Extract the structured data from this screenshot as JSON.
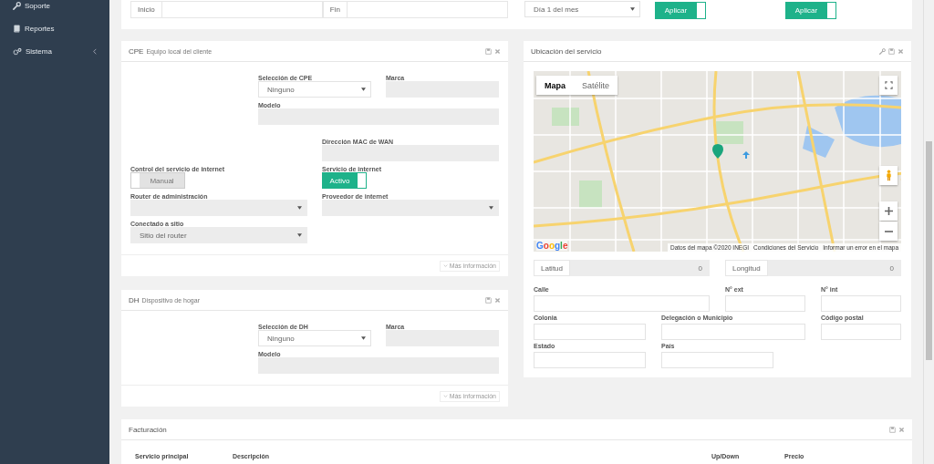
{
  "sidebar": {
    "items": [
      {
        "label": "Soporte",
        "has_submenu": false
      },
      {
        "label": "Reportes",
        "has_submenu": false
      },
      {
        "label": "Sistema",
        "has_submenu": true
      }
    ]
  },
  "filters": {
    "start_label": "Inicio",
    "end_label": "Fin",
    "period": "Día 1 del mes",
    "toggles": [
      {
        "text": "Aplicar",
        "on": true
      },
      {
        "text": "Aplicar",
        "on": true
      }
    ]
  },
  "cpe_panel": {
    "title": "CPE",
    "subtitle": "Equipo local del cliente",
    "more_button": "Más información",
    "fields": [
      {
        "kind": "select",
        "label": "Selección de CPE",
        "value": "Ninguno",
        "disabled": false
      },
      {
        "kind": "input",
        "label": "Marca",
        "disabled": true
      },
      {
        "kind": "input",
        "label": "Modelo",
        "disabled": true
      },
      {
        "kind": "input",
        "label": "Dirección MAC de WAN",
        "disabled": true
      },
      {
        "kind": "toggle",
        "label": "Control del servicio de internet",
        "text": "Manual",
        "on": false
      },
      {
        "kind": "toggle",
        "label": "Servicio de internet",
        "text": "Activo",
        "on": true
      },
      {
        "kind": "select",
        "label": "Router de administración",
        "disabled": true
      },
      {
        "kind": "select",
        "label": "Proveedor de internet",
        "disabled": true
      },
      {
        "kind": "select",
        "label": "Conectado a sitio",
        "value": "Sitio del router",
        "disabled": true
      }
    ]
  },
  "dh_panel": {
    "title": "DH",
    "subtitle": "Dispositivo de hogar",
    "more_button": "Más información",
    "fields": [
      {
        "kind": "select",
        "label": "Selección de DH",
        "value": "Ninguno",
        "disabled": false
      },
      {
        "kind": "input",
        "label": "Marca",
        "disabled": true
      },
      {
        "kind": "input",
        "label": "Modelo",
        "disabled": true
      }
    ]
  },
  "location_panel": {
    "title": "Ubicación del servicio",
    "map": {
      "tabs": [
        {
          "label": "Mapa",
          "selected": true
        },
        {
          "label": "Satélite",
          "selected": false
        }
      ],
      "logo": "Google",
      "attribution": [
        "Datos del mapa ©2020 INEGI",
        "Condiciones del Servicio",
        "Informar un error en el mapa"
      ]
    },
    "coordinates": [
      {
        "label": "Latitud",
        "value": "0"
      },
      {
        "label": "Longitud",
        "value": "0"
      }
    ],
    "fields": [
      {
        "kind": "input",
        "label": "Calle",
        "disabled": false
      },
      {
        "kind": "input",
        "label": "N° ext",
        "disabled": false
      },
      {
        "kind": "input",
        "label": "N° int",
        "disabled": false
      },
      {
        "kind": "input",
        "label": "Colonia",
        "disabled": false
      },
      {
        "kind": "input",
        "label": "Delegación o Municipio",
        "disabled": false
      },
      {
        "kind": "input",
        "label": "Código postal",
        "disabled": false
      },
      {
        "kind": "input",
        "label": "Estado",
        "disabled": false
      },
      {
        "kind": "input",
        "label": "País",
        "disabled": false
      }
    ]
  },
  "billing_panel": {
    "title": "Facturación",
    "columns": [
      "Servicio principal",
      "Descripción",
      "Up/Down",
      "Precio"
    ]
  }
}
